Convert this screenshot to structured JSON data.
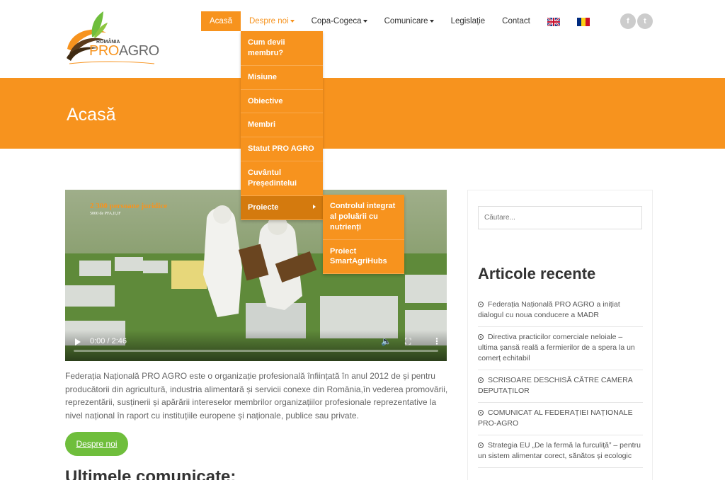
{
  "brand": {
    "top": "ROMÂNIA",
    "pro": "PRO",
    "agro": "AGRO"
  },
  "nav": {
    "items": [
      "Acasă",
      "Despre noi",
      "Copa-Cogeca",
      "Comunicare",
      "Legislație",
      "Contact"
    ],
    "social": [
      "f",
      "t"
    ]
  },
  "hero": {
    "title": "Acasă"
  },
  "dropdown": {
    "items": [
      "Cum devii membru?",
      "Misiune",
      "Obiective",
      "Membri",
      "Statut PRO AGRO",
      "Cuvântul Președintelui",
      "Proiecte"
    ],
    "submenu": [
      "Controlul integrat al poluării cu nutrienți",
      "Proiect SmartAgriHubs"
    ]
  },
  "video": {
    "overlay": "2 300 persoane juridice",
    "overlay_sub": "5000 de PFA,II,IF",
    "time": "0:00 / 2:46",
    "progress": 0
  },
  "intro": "Federația Națională PRO AGRO este o organizație profesională înființată în anul 2012 de și pentru producătorii din agricultură, industria alimentară și servicii conexe din România,în vederea promovării, reprezentării, susținerii și apărării intereselor membrilor organizațiilor profesionale reprezentative la nivel național în raport cu instituțiile europene și naționale, publice sau private.",
  "about_button": "Despre noi",
  "section_heading": "Ultimele comunicate:",
  "sidebar": {
    "search_placeholder": "Căutare...",
    "recent_title": "Articole recente",
    "recent": [
      "Federația Națională PRO AGRO a inițiat dialogul cu noua conducere a MADR",
      "Directiva practicilor comerciale neloiale – ultima șansă reală a fermierilor de a spera la un comerț echitabil",
      "SCRISOARE DESCHISĂ CĂTRE CAMERA DEPUTAȚILOR",
      "COMUNICAT AL FEDERAȚIEI NAȚIONALE PRO-AGRO",
      "Strategia EU „De la fermă la furculiță” – pentru un sistem alimentar corect, sănătos și ecologic"
    ]
  },
  "colors": {
    "accent": "#f7931e",
    "green": "#6fbe3c"
  }
}
